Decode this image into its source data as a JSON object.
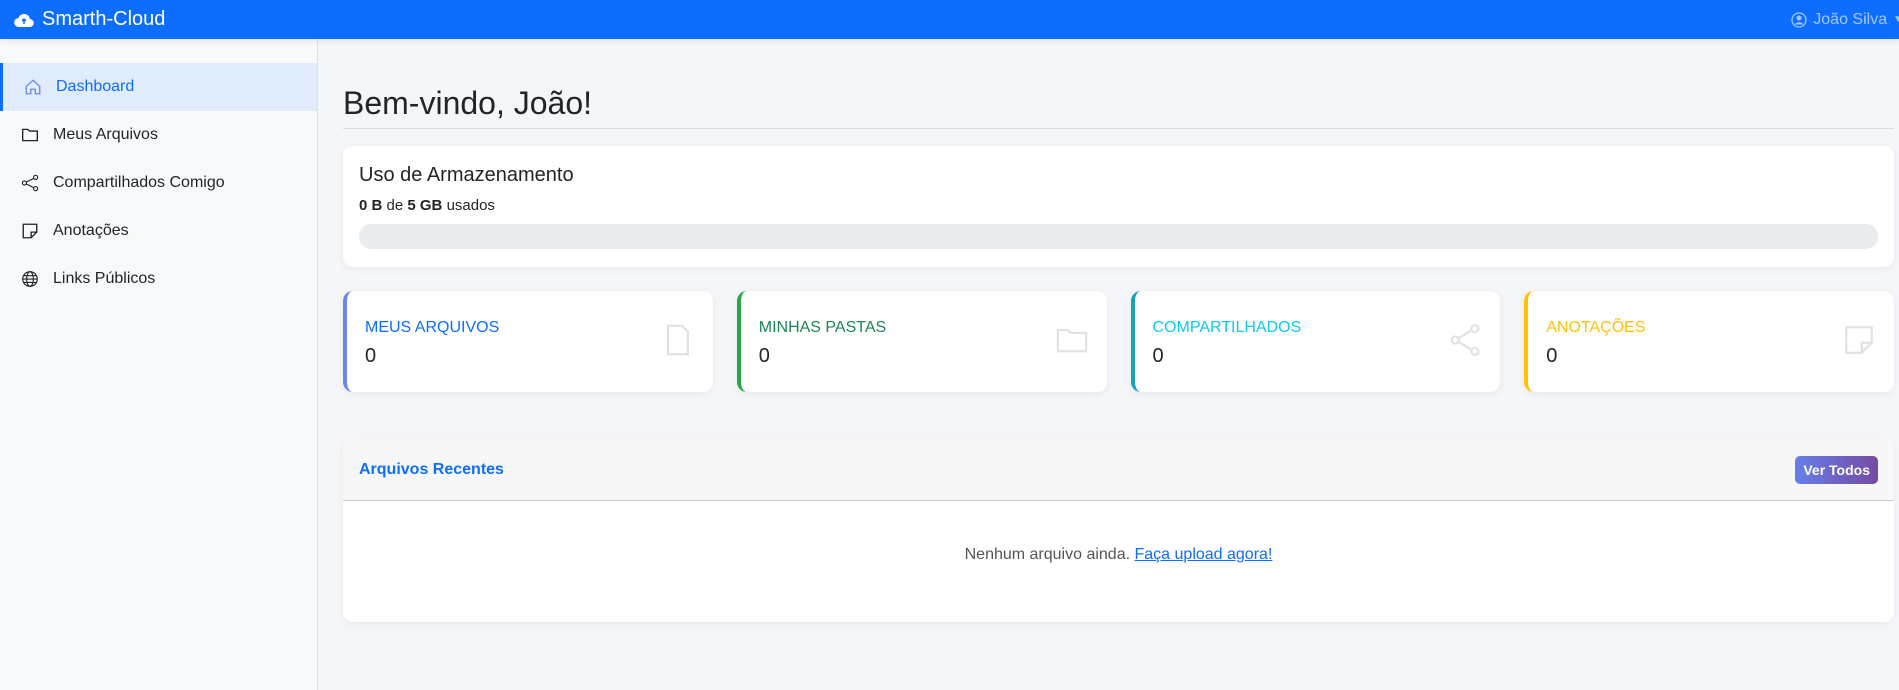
{
  "navbar": {
    "brand": "Smarth-Cloud",
    "user": "João Silva"
  },
  "sidebar": {
    "items": [
      {
        "label": "Dashboard",
        "icon": "house-icon",
        "active": true
      },
      {
        "label": "Meus Arquivos",
        "icon": "folder-icon"
      },
      {
        "label": "Compartilhados Comigo",
        "icon": "share-icon"
      },
      {
        "label": "Anotações",
        "icon": "sticky-note-icon"
      },
      {
        "label": "Links Públicos",
        "icon": "globe-icon"
      }
    ]
  },
  "main": {
    "title": "Bem-vindo, João!",
    "storage": {
      "title": "Uso de Armazenamento",
      "used": "0 B",
      "of": "de",
      "total": "5 GB",
      "suffix": "usados",
      "percent": 0
    },
    "stats": [
      {
        "label": "MEUS ARQUIVOS",
        "value": "0",
        "color": "#0d6efd",
        "border": "#6f86e8",
        "icon": "file-icon"
      },
      {
        "label": "MINHAS PASTAS",
        "value": "0",
        "color": "#198754",
        "border": "#28a745",
        "icon": "folder-icon"
      },
      {
        "label": "COMPARTILHADOS",
        "value": "0",
        "color": "#0dcaf0",
        "border": "#17a2b8",
        "icon": "share-icon"
      },
      {
        "label": "ANOTAÇÕES",
        "value": "0",
        "color": "#ffc107",
        "border": "#ffc107",
        "icon": "sticky-note-icon"
      }
    ],
    "recent": {
      "title": "Arquivos Recentes",
      "view_all": "Ver Todos",
      "empty_text": "Nenhum arquivo ainda.",
      "upload_link": "Faça upload agora!"
    }
  }
}
